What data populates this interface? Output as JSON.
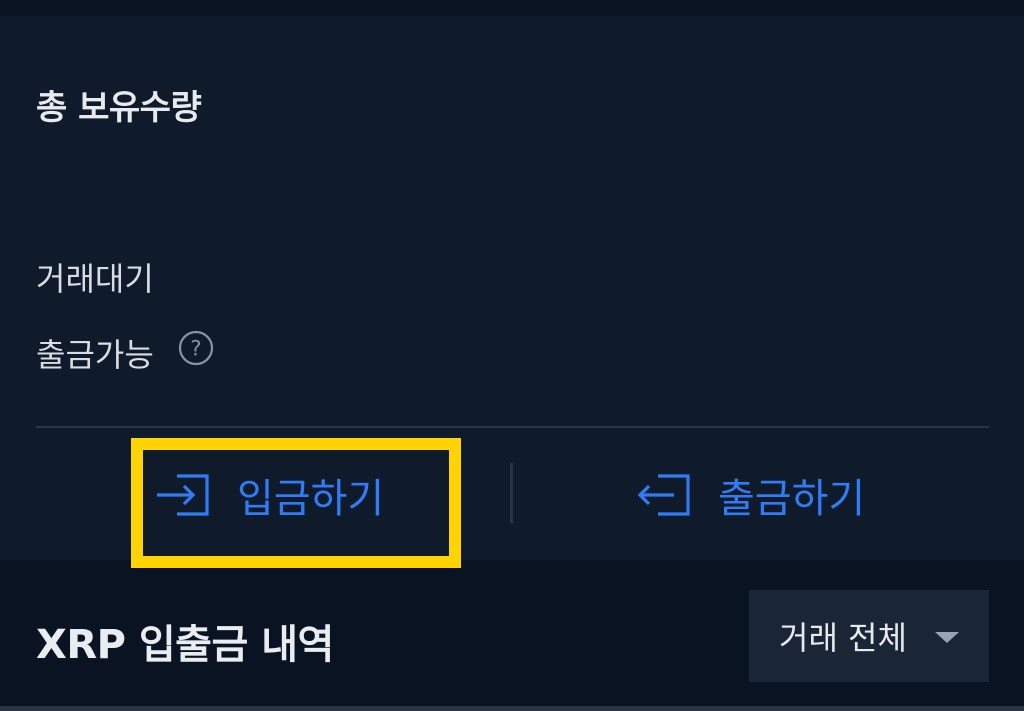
{
  "holdings": {
    "title": "총 보유수량",
    "pending_label": "거래대기",
    "withdrawable_label": "출금가능",
    "help_icon": "question-circle-icon"
  },
  "actions": {
    "deposit_label": "입금하기",
    "deposit_icon": "login-arrow-icon",
    "withdraw_label": "출금하기",
    "withdraw_icon": "logout-arrow-icon",
    "accent_color": "#2f7cf6"
  },
  "history": {
    "title": "XRP 입출금 내역",
    "filter_selected": "거래 전체",
    "filter_icon": "caret-down-icon"
  },
  "annotation": {
    "highlight_color": "#ffd400"
  }
}
